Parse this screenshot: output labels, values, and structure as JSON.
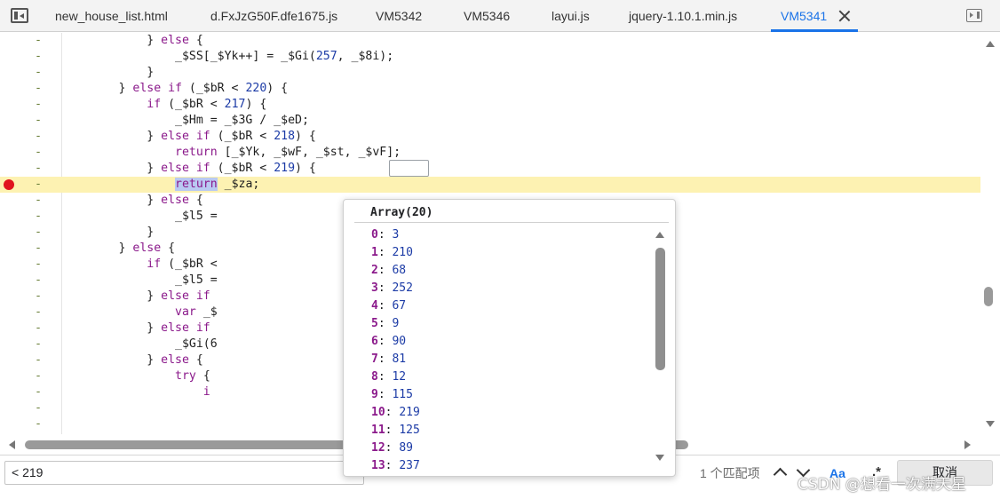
{
  "tabs": [
    {
      "label": "new_house_list.html"
    },
    {
      "label": "d.FxJzG50F.dfe1675.js"
    },
    {
      "label": "VM5342"
    },
    {
      "label": "VM5346"
    },
    {
      "label": "layui.js"
    },
    {
      "label": "jquery-1.10.1.min.js"
    },
    {
      "label": "VM5341",
      "active": true
    }
  ],
  "code": {
    "line_marker": "-",
    "lines": [
      {
        "parts": [
          {
            "t": "            } "
          },
          {
            "t": "else",
            "c": "kw"
          },
          {
            "t": " {"
          }
        ]
      },
      {
        "parts": [
          {
            "t": "                _$SS[_$Yk++] = _$Gi("
          },
          {
            "t": "257",
            "c": "num"
          },
          {
            "t": ", _$8i);"
          }
        ]
      },
      {
        "parts": [
          {
            "t": "            }"
          }
        ]
      },
      {
        "parts": [
          {
            "t": "        } "
          },
          {
            "t": "else if",
            "c": "kw"
          },
          {
            "t": " (_$bR < "
          },
          {
            "t": "220",
            "c": "num"
          },
          {
            "t": ") {"
          }
        ]
      },
      {
        "parts": [
          {
            "t": "            "
          },
          {
            "t": "if",
            "c": "kw"
          },
          {
            "t": " (_$bR < "
          },
          {
            "t": "217",
            "c": "num"
          },
          {
            "t": ") {"
          }
        ]
      },
      {
        "parts": [
          {
            "t": "                _$Hm = _$3G / _$eD;"
          }
        ]
      },
      {
        "parts": [
          {
            "t": "            } "
          },
          {
            "t": "else if",
            "c": "kw"
          },
          {
            "t": " (_$bR < "
          },
          {
            "t": "218",
            "c": "num"
          },
          {
            "t": ") {"
          }
        ]
      },
      {
        "parts": [
          {
            "t": "                "
          },
          {
            "t": "return",
            "c": "kw"
          },
          {
            "t": " [_$Yk, _$wF, _$st, _$vF];"
          }
        ]
      },
      {
        "parts": [
          {
            "t": "            } "
          },
          {
            "t": "else if",
            "c": "kw"
          },
          {
            "t": " (_$bR < "
          },
          {
            "t": "219",
            "c": "num"
          },
          {
            "t": ") {"
          }
        ]
      },
      {
        "parts": [
          {
            "t": "                "
          },
          {
            "t": "return",
            "c": "kw sel"
          },
          {
            "t": " _$za;"
          }
        ],
        "highlight": true,
        "breakpoint": true
      },
      {
        "parts": [
          {
            "t": "            } "
          },
          {
            "t": "else",
            "c": "kw"
          },
          {
            "t": " {"
          }
        ]
      },
      {
        "parts": [
          {
            "t": "                _$l5 ="
          }
        ]
      },
      {
        "parts": [
          {
            "t": "            }"
          }
        ]
      },
      {
        "parts": [
          {
            "t": "        } "
          },
          {
            "t": "else",
            "c": "kw"
          },
          {
            "t": " {"
          }
        ]
      },
      {
        "parts": [
          {
            "t": "            "
          },
          {
            "t": "if",
            "c": "kw"
          },
          {
            "t": " (_$bR <"
          }
        ]
      },
      {
        "parts": [
          {
            "t": "                _$l5 ="
          }
        ]
      },
      {
        "parts": [
          {
            "t": "            } "
          },
          {
            "t": "else if",
            "c": "kw"
          }
        ]
      },
      {
        "parts": [
          {
            "t": "                "
          },
          {
            "t": "var",
            "c": "kw"
          },
          {
            "t": " _$"
          }
        ]
      },
      {
        "parts": [
          {
            "t": "            } "
          },
          {
            "t": "else if",
            "c": "kw"
          }
        ]
      },
      {
        "parts": [
          {
            "t": "                _$Gi(6"
          }
        ]
      },
      {
        "parts": [
          {
            "t": "            } "
          },
          {
            "t": "else",
            "c": "kw"
          },
          {
            "t": " {"
          }
        ]
      },
      {
        "parts": [
          {
            "t": "                "
          },
          {
            "t": "try",
            "c": "kw"
          },
          {
            "t": " {"
          }
        ]
      },
      {
        "parts": [
          {
            "t": "                    "
          },
          {
            "t": "i",
            "c": "kw"
          }
        ]
      },
      {
        "parts": [
          {
            "t": ""
          }
        ]
      },
      {
        "parts": [
          {
            "t": ""
          }
        ]
      }
    ]
  },
  "popover": {
    "title": "Array(20)",
    "items": [
      {
        "key": "0",
        "value": "3"
      },
      {
        "key": "1",
        "value": "210"
      },
      {
        "key": "2",
        "value": "68"
      },
      {
        "key": "3",
        "value": "252"
      },
      {
        "key": "4",
        "value": "67"
      },
      {
        "key": "5",
        "value": "9"
      },
      {
        "key": "6",
        "value": "90"
      },
      {
        "key": "7",
        "value": "81"
      },
      {
        "key": "8",
        "value": "12"
      },
      {
        "key": "9",
        "value": "115"
      },
      {
        "key": "10",
        "value": "219"
      },
      {
        "key": "11",
        "value": "125"
      },
      {
        "key": "12",
        "value": "89"
      },
      {
        "key": "13",
        "value": "237"
      }
    ]
  },
  "search": {
    "value": "< 219",
    "match_count": "1 个匹配项",
    "case_label": "Aa",
    "regex_label": ".*",
    "cancel_label": "取消"
  },
  "watermark": "CSDN @想看一次满天星",
  "colors": {
    "accent": "#1a73e8",
    "breakpoint": "#e0141e",
    "highlight_line": "#fdf2b2",
    "keyword": "#8b1a8b",
    "number": "#1c3ba6"
  }
}
